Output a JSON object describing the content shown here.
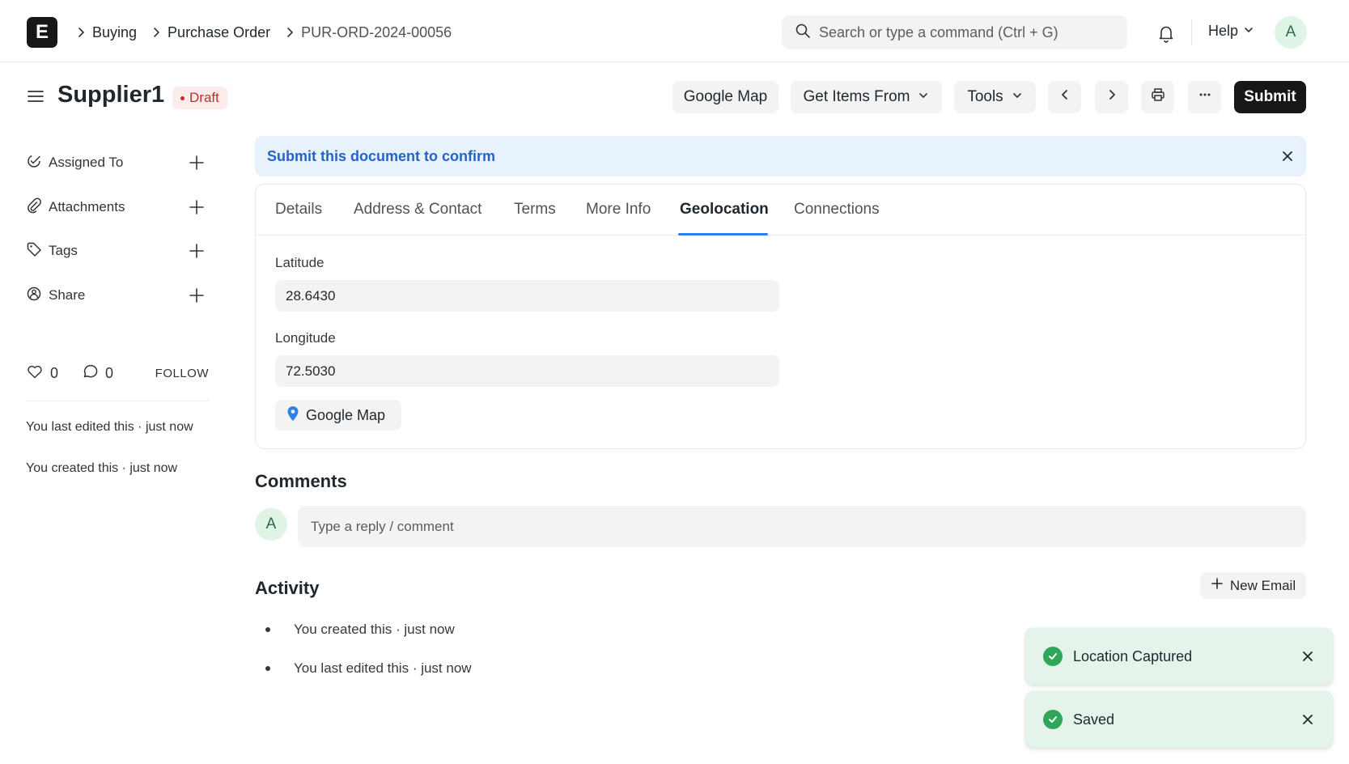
{
  "navbar": {
    "logo_letter": "E",
    "breadcrumbs": [
      "Buying",
      "Purchase Order",
      "PUR-ORD-2024-00056"
    ],
    "search_placeholder": "Search or type a command (Ctrl + G)",
    "help_label": "Help",
    "avatar_letter": "A"
  },
  "page": {
    "title": "Supplier1",
    "status": "Draft",
    "status_color": "#c92a2a"
  },
  "actions": {
    "google_map": "Google Map",
    "get_items_from": "Get Items From",
    "tools": "Tools",
    "submit": "Submit"
  },
  "sidebar": {
    "items": [
      {
        "label": "Assigned To",
        "icon": "assign-icon"
      },
      {
        "label": "Attachments",
        "icon": "paperclip-icon"
      },
      {
        "label": "Tags",
        "icon": "tag-icon"
      },
      {
        "label": "Share",
        "icon": "share-icon"
      }
    ],
    "likes": "0",
    "comments": "0",
    "follow": "FOLLOW",
    "last_edited": "You last edited this",
    "last_edited_time": "just now",
    "created": "You created this",
    "created_time": "just now"
  },
  "alert": {
    "text": "Submit this document to confirm",
    "color": "#2564c7"
  },
  "tabs": [
    "Details",
    "Address & Contact",
    "Terms",
    "More Info",
    "Geolocation",
    "Connections"
  ],
  "active_tab": "Geolocation",
  "geolocation": {
    "latitude_label": "Latitude",
    "latitude": "28.6430",
    "longitude_label": "Longitude",
    "longitude": "72.5030",
    "map_button": "Google Map"
  },
  "comments": {
    "title": "Comments",
    "avatar_letter": "A",
    "placeholder": "Type a reply / comment"
  },
  "activity": {
    "title": "Activity",
    "new_email": "New Email",
    "items": [
      {
        "text": "You created this",
        "time": "just now"
      },
      {
        "text": "You last edited this",
        "time": "just now"
      }
    ]
  },
  "toasts": [
    {
      "text": "Location Captured"
    },
    {
      "text": "Saved"
    }
  ],
  "colors": {
    "accent": "#2f80ed",
    "success": "#30a65b",
    "dark_button": "#171717"
  }
}
